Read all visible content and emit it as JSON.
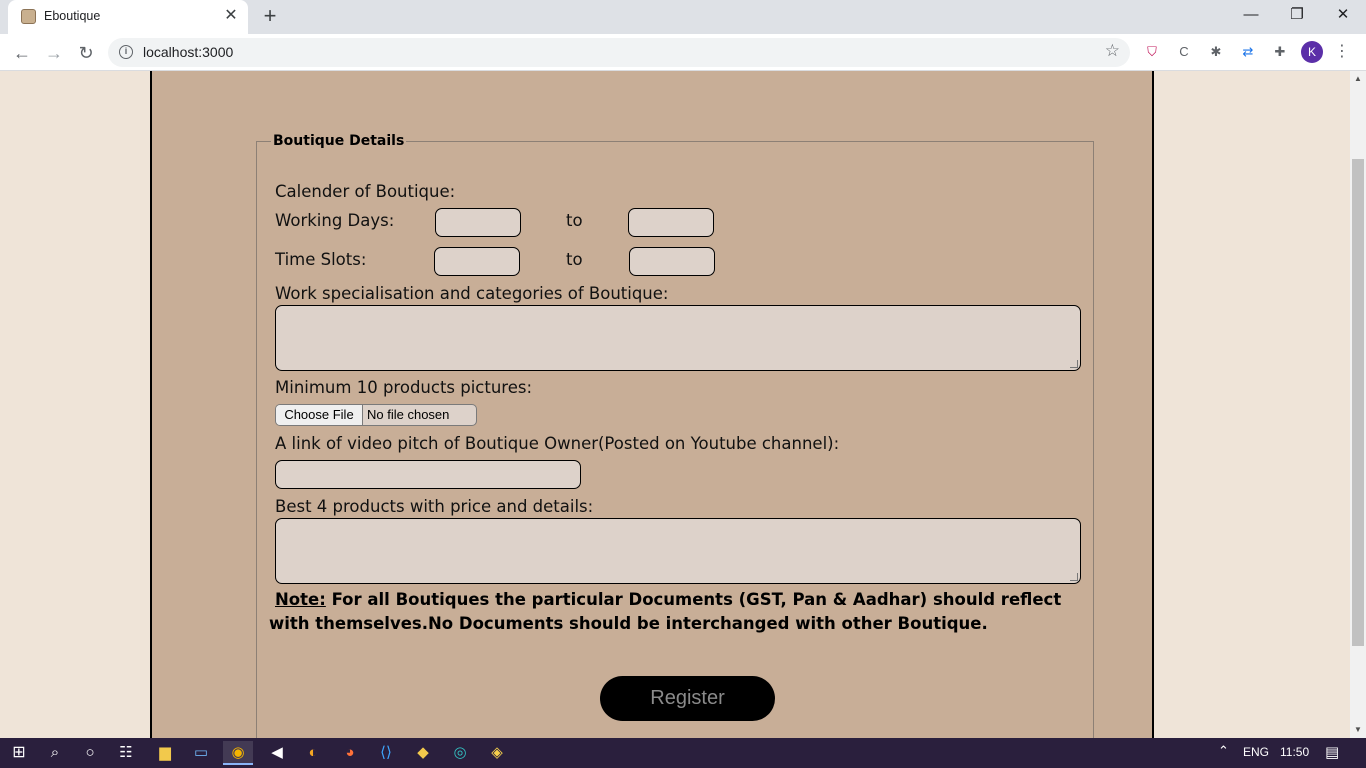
{
  "browser": {
    "tab_title": "Eboutique",
    "tab_close": "✕",
    "new_tab": "+",
    "url": "localhost:3000",
    "window_controls": {
      "minimize": "—",
      "restore": "❐",
      "close": "✕"
    },
    "nav": {
      "back": "←",
      "forward": "→",
      "reload": "↻"
    },
    "star": "☆",
    "profile_initial": "K",
    "menu": "⋮",
    "extensions": [
      "shield-icon",
      "code-icon",
      "bug-icon",
      "sync-icon",
      "puzzle-icon"
    ]
  },
  "form": {
    "legend": "Boutique Details",
    "calendar_label": "Calender of Boutique:",
    "working_days_label": "Working Days:",
    "time_slots_label": "Time Slots:",
    "to_label": "to",
    "working_days_from": "",
    "working_days_to": "",
    "time_slots_from": "",
    "time_slots_to": "",
    "specialisation_label": "Work specialisation and categories of Boutique:",
    "specialisation_value": "",
    "pictures_label": "Minimum 10 products pictures:",
    "file_button": "Choose File",
    "file_status": "No file chosen",
    "video_label": "A link of video pitch of Boutique Owner(Posted on Youtube channel):",
    "video_value": "",
    "best_products_label": "Best 4 products with price and details:",
    "best_products_value": "",
    "note_head": "Note:",
    "note_text": " For all Boutiques the particular Documents (GST, Pan & Aadhar) should reflect with themselves.No Documents should be interchanged with other Boutique.",
    "register_label": "Register"
  },
  "taskbar": {
    "language": "ENG",
    "time": "11:50"
  },
  "colors": {
    "page_bg": "#efe4d8",
    "card_bg": "#c8ae97",
    "input_bg": "#ddd2ca",
    "button_bg": "#000000",
    "taskbar_bg": "#2a1f3d"
  }
}
